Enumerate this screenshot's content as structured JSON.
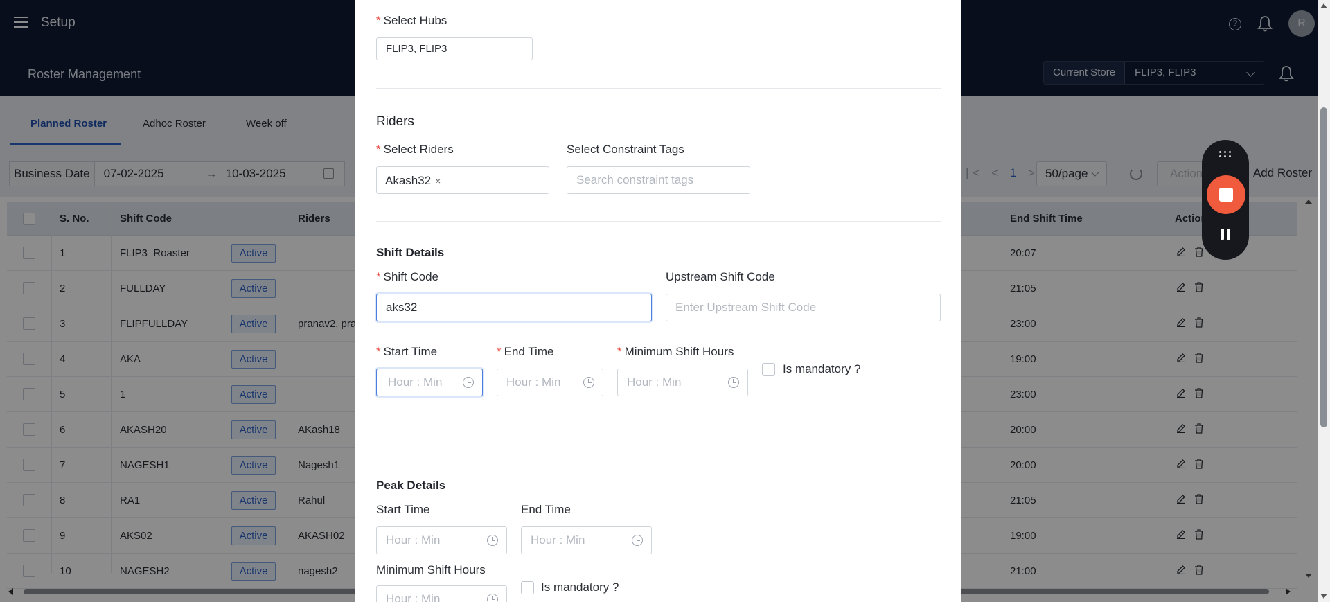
{
  "topbar": {
    "title": "Setup",
    "avatar_initial": "R",
    "help_glyph": "?"
  },
  "subbar": {
    "title": "Roster Management",
    "current_store_label": "Current Store",
    "current_store_value": "FLIP3, FLIP3"
  },
  "tabs": [
    {
      "label": "Planned Roster",
      "active": true
    },
    {
      "label": "Adhoc Roster",
      "active": false
    },
    {
      "label": "Week off",
      "active": false
    }
  ],
  "filters": {
    "business_date_label": "Business Date",
    "date_from": "07-02-2025",
    "date_to": "10-03-2025",
    "date_arrow": "→",
    "pager_first": "|<",
    "pager_prev": "<",
    "pager_current": "1",
    "pager_next": ">",
    "per_page": "50/page",
    "actions_label": "Actions",
    "add_label": "Add Roster"
  },
  "table": {
    "headers": {
      "sno": "S. No.",
      "shift_code": "Shift Code",
      "riders": "Riders",
      "end_shift_time": "End Shift Time",
      "actions": "Actions"
    },
    "rows": [
      {
        "sno": "1",
        "shift_code": "FLIP3_Roaster",
        "status": "Active",
        "riders": "",
        "end": "20:07"
      },
      {
        "sno": "2",
        "shift_code": "FULLDAY",
        "status": "Active",
        "riders": "",
        "end": "21:05"
      },
      {
        "sno": "3",
        "shift_code": "FLIPFULLDAY",
        "status": "Active",
        "riders": "pranav2, pra",
        "end": "23:00"
      },
      {
        "sno": "4",
        "shift_code": "AKA",
        "status": "Active",
        "riders": "",
        "end": "19:00"
      },
      {
        "sno": "5",
        "shift_code": "1",
        "status": "Active",
        "riders": "",
        "end": "23:00"
      },
      {
        "sno": "6",
        "shift_code": "AKASH20",
        "status": "Active",
        "riders": "AKash18",
        "end": "20:00"
      },
      {
        "sno": "7",
        "shift_code": "NAGESH1",
        "status": "Active",
        "riders": "Nagesh1",
        "end": "20:00"
      },
      {
        "sno": "8",
        "shift_code": "RA1",
        "status": "Active",
        "riders": "Rahul",
        "end": "21:05"
      },
      {
        "sno": "9",
        "shift_code": "AKS02",
        "status": "Active",
        "riders": "AKASH02",
        "end": "19:00"
      },
      {
        "sno": "10",
        "shift_code": "NAGESH2",
        "status": "Active",
        "riders": "nagesh2",
        "end": "21:00"
      }
    ]
  },
  "modal": {
    "hubs": {
      "label": "Select Hubs",
      "value": "FLIP3, FLIP3"
    },
    "riders_section": {
      "title": "Riders",
      "select_riders_label": "Select Riders",
      "selected_tag": "Akash32",
      "tag_remove": "×",
      "constraint_label": "Select Constraint Tags",
      "constraint_placeholder": "Search constraint tags"
    },
    "shift_details": {
      "title": "Shift Details",
      "shift_code_label": "Shift Code",
      "shift_code_value": "aks32",
      "upstream_label": "Upstream Shift Code",
      "upstream_placeholder": "Enter Upstream Shift Code",
      "start_time_label": "Start Time",
      "end_time_label": "End Time",
      "min_hours_label": "Minimum Shift Hours",
      "time_placeholder": "Hour : Min",
      "mandatory_label": "Is mandatory ?"
    },
    "peak_details": {
      "title": "Peak Details",
      "start_time_label": "Start Time",
      "end_time_label": "End Time",
      "min_hours_label": "Minimum Shift Hours",
      "time_placeholder": "Hour : Min",
      "mandatory_label": "Is mandatory ?"
    }
  }
}
